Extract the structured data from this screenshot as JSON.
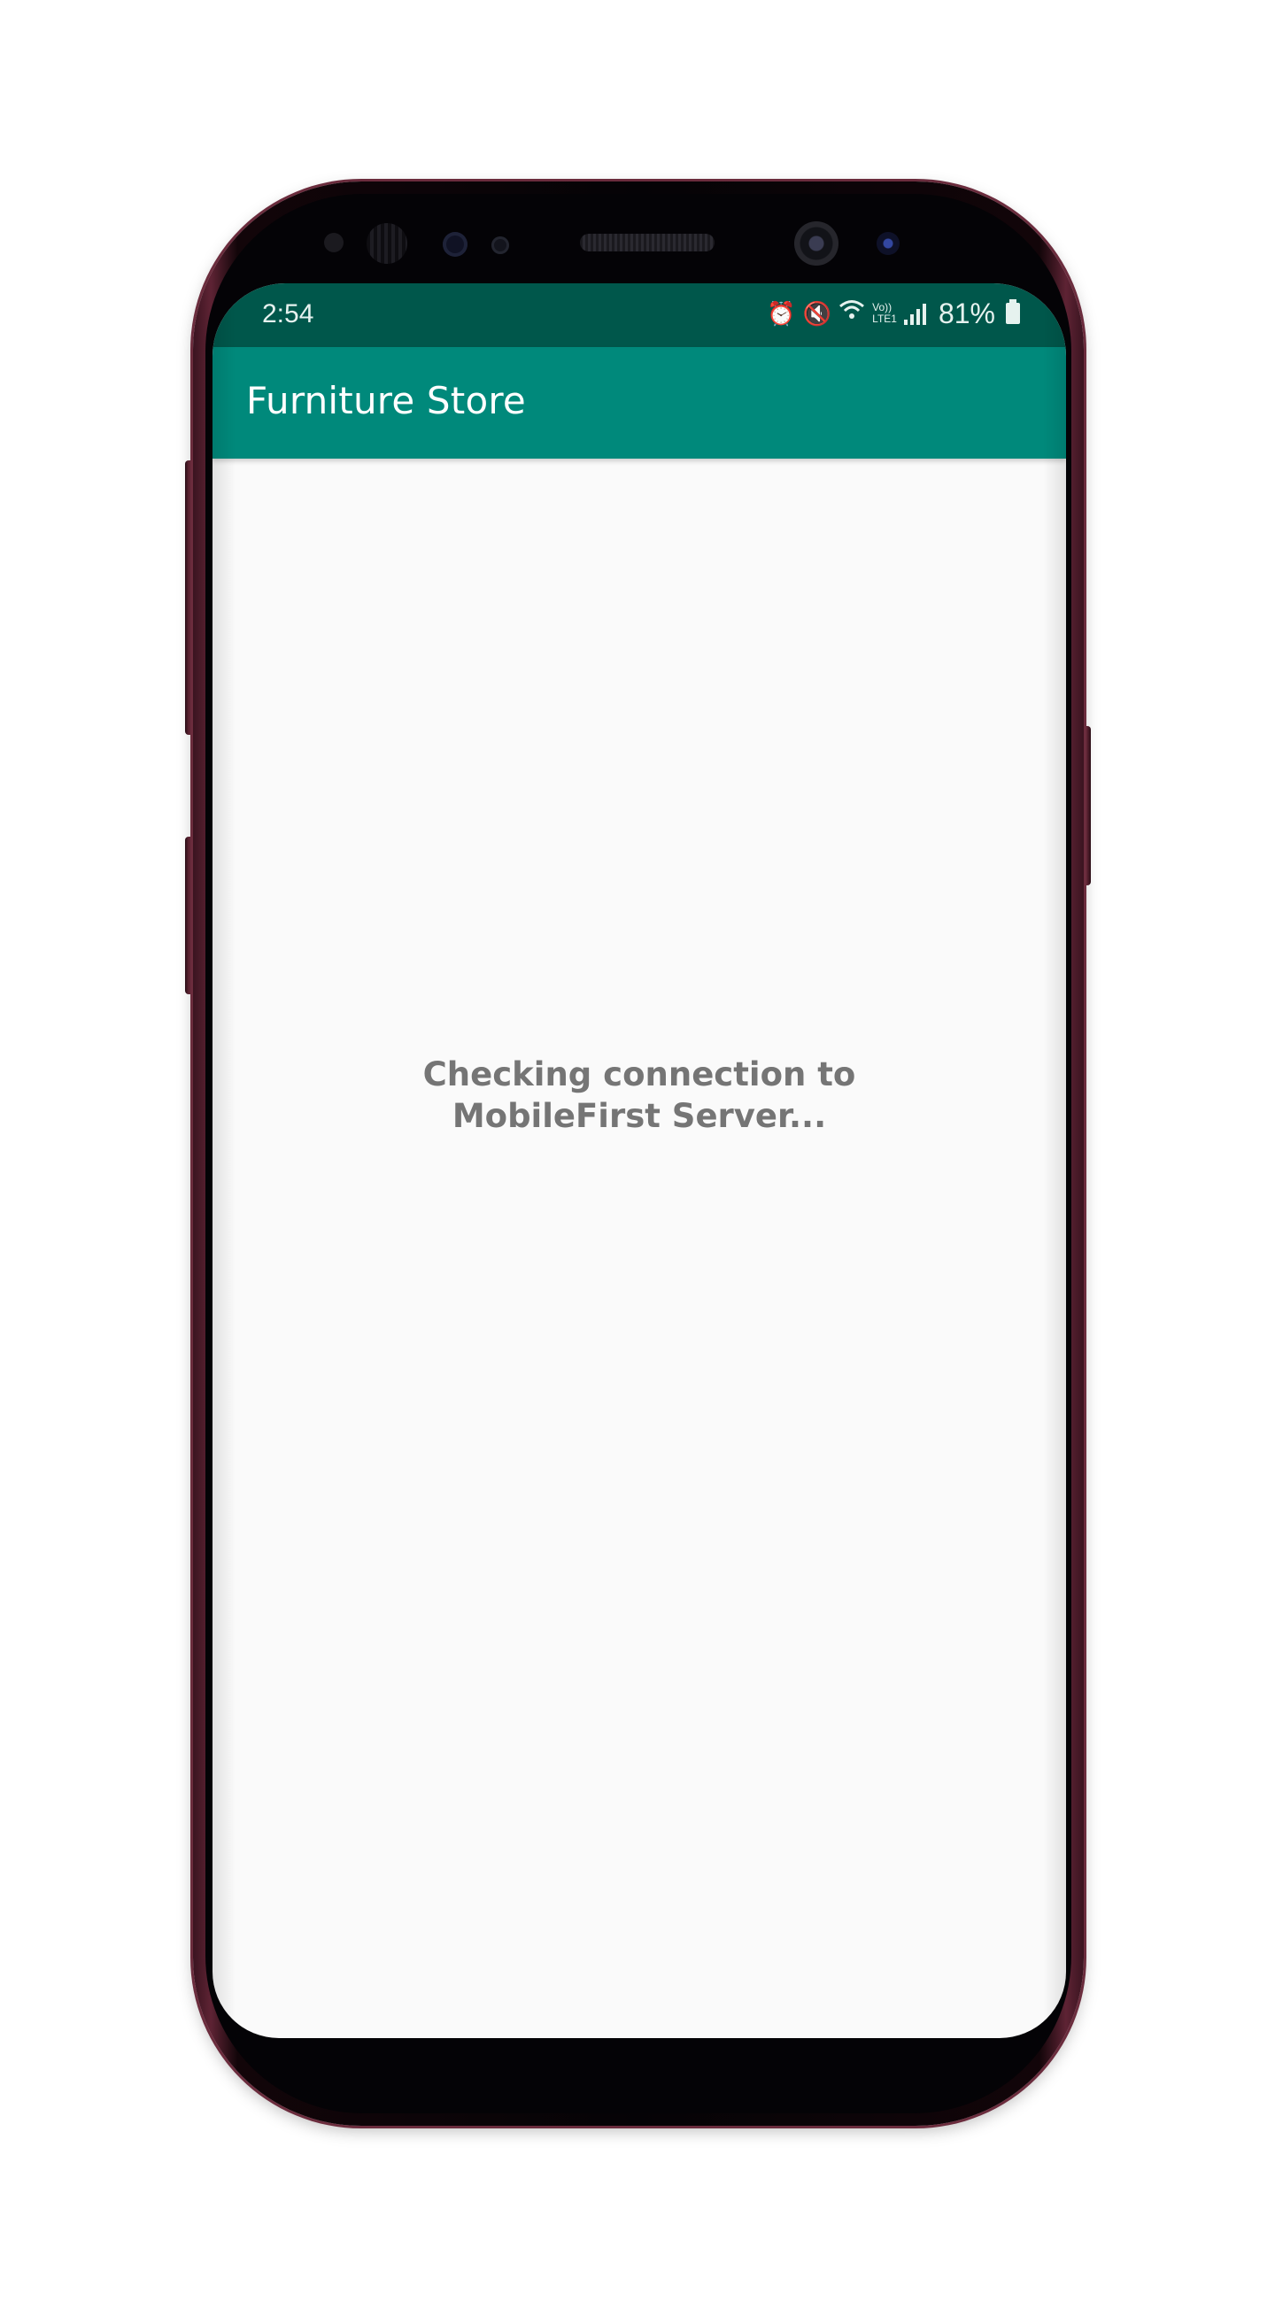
{
  "status_bar": {
    "time": "2:54",
    "icons": [
      "alarm-icon",
      "mute-icon",
      "wifi-icon",
      "volte-lte-icon",
      "signal-icon"
    ],
    "lte_top": "Vo))",
    "lte_bottom": "LTE1",
    "battery_percent": "81%"
  },
  "app_bar": {
    "title": "Furniture Store",
    "color": "#00897b",
    "status_color": "#00574b"
  },
  "main": {
    "message_line1": "Checking connection to",
    "message_line2": "MobileFirst Server..."
  }
}
